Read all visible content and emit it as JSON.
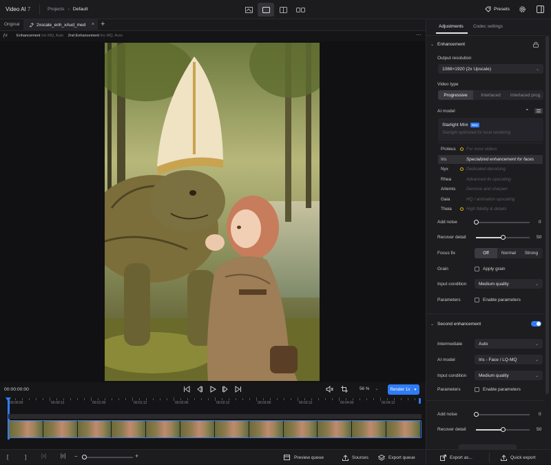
{
  "app": {
    "name": "Video AI",
    "version": "7"
  },
  "breadcrumb": {
    "root": "Projects",
    "current": "Default"
  },
  "topbar": {
    "presets_label": "Presets"
  },
  "tabs": {
    "original": "Original",
    "active": "2xscale_enh_xAud_med"
  },
  "info": {
    "enh_label": "Enhancement",
    "enh_value": "Iris MQ, Auto",
    "enh2_label": "2nd Enhancement",
    "enh2_value": "Iris MQ, Auto"
  },
  "controls": {
    "timecode": "00:00:00:00",
    "zoom": "56 %",
    "render_label": "Render 1x"
  },
  "timeline": {
    "ticks": [
      "00:00:00",
      "00:00:12",
      "00:01:00",
      "00:01:12",
      "00:02:00",
      "00:02:12",
      "00:03:00",
      "00:03:12",
      "00:04:00",
      "00:04:12"
    ]
  },
  "bottom": {
    "preview_queue": "Preview queue",
    "sources": "Sources",
    "export_queue": "Export queue",
    "export_as": "Export as...",
    "quick_export": "Quick export"
  },
  "panel": {
    "tabs": [
      "Adjustments",
      "Codec settings"
    ],
    "enhancement": {
      "title": "Enhancement",
      "output_resolution_label": "Output resolution",
      "output_resolution": "1088×1920 (2x Upscale)",
      "video_type_label": "Video type",
      "video_types": [
        "Progressive",
        "Interlaced",
        "Interlaced prog."
      ],
      "ai_model_label": "AI model",
      "starlight": {
        "name": "Starlight Mini",
        "badge": "New",
        "desc": "Starlight optimized for local rendering"
      },
      "models": [
        {
          "name": "Proteus",
          "desc": "For most videos",
          "dot": true
        },
        {
          "name": "Iris",
          "desc": "Specialized enhancement for faces",
          "dot": false
        },
        {
          "name": "Nyx",
          "desc": "Dedicated denoising",
          "dot": true
        },
        {
          "name": "Rhea",
          "desc": "Advanced 4x upscaling",
          "dot": false
        },
        {
          "name": "Artemis",
          "desc": "Denoise and sharpen",
          "dot": false
        },
        {
          "name": "Gaia",
          "desc": "HQ / animation upscaling",
          "dot": false
        },
        {
          "name": "Theia",
          "desc": "High fidelity & details",
          "dot": true
        }
      ],
      "add_noise_label": "Add noise",
      "add_noise_value": 0,
      "recover_detail_label": "Recover detail",
      "recover_detail_value": 50,
      "focus_fix_label": "Focus fix",
      "focus_fix_options": [
        "Off",
        "Normal",
        "Strong"
      ],
      "grain_label": "Grain",
      "grain_option": "Apply grain",
      "input_condition_label": "Input condition",
      "input_condition": "Medium quality",
      "parameters_label": "Parameters",
      "parameters_option": "Enable parameters"
    },
    "second": {
      "title": "Second enhancement",
      "intermediate_label": "Intermediate",
      "intermediate": "Auto",
      "ai_model_label": "AI model",
      "ai_model": "Iris - Face / LQ-MQ",
      "input_condition_label": "Input condition",
      "input_condition": "Medium quality",
      "parameters_label": "Parameters",
      "parameters_option": "Enable parameters",
      "add_noise_label": "Add noise",
      "add_noise_value": 0,
      "recover_detail_label": "Recover detail",
      "recover_detail_value": 50
    }
  },
  "colors": {
    "accent": "#2f7cf6",
    "dot": "#e0b020"
  }
}
